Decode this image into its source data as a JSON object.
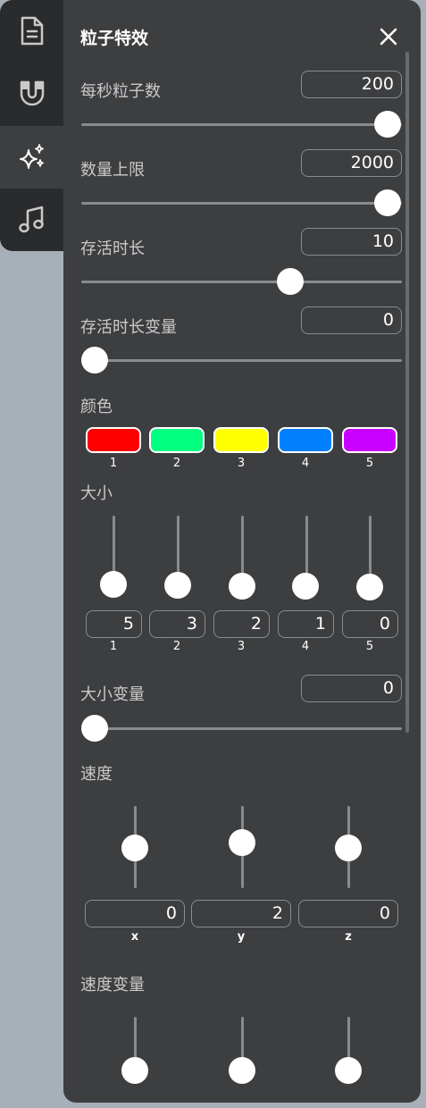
{
  "panel": {
    "title": "粒子特效"
  },
  "rail": {
    "items": [
      {
        "icon": "document-icon"
      },
      {
        "icon": "magnet-icon"
      },
      {
        "icon": "sparkles-icon",
        "active": true
      },
      {
        "icon": "music-note-icon"
      }
    ]
  },
  "controls": {
    "rate": {
      "label": "每秒粒子数",
      "value": "200",
      "fraction": 1.0
    },
    "max": {
      "label": "数量上限",
      "value": "2000",
      "fraction": 1.0
    },
    "life": {
      "label": "存活时长",
      "value": "10",
      "fraction": 0.65
    },
    "life_var": {
      "label": "存活时长变量",
      "value": "0",
      "fraction": 0.0
    },
    "size_var": {
      "label": "大小变量",
      "value": "0",
      "fraction": 0.0
    }
  },
  "colors": {
    "label": "颜色",
    "swatches": [
      {
        "index": "1",
        "color": "#ff0000"
      },
      {
        "index": "2",
        "color": "#00ff80"
      },
      {
        "index": "3",
        "color": "#ffff00"
      },
      {
        "index": "4",
        "color": "#0080ff"
      },
      {
        "index": "5",
        "color": "#c800ff"
      }
    ]
  },
  "size": {
    "label": "大小",
    "sliders": [
      {
        "index": "1",
        "value": "5"
      },
      {
        "index": "2",
        "value": "3"
      },
      {
        "index": "3",
        "value": "2"
      },
      {
        "index": "4",
        "value": "1"
      },
      {
        "index": "5",
        "value": "0"
      }
    ]
  },
  "velocity": {
    "label": "速度",
    "sliders": [
      {
        "axis": "x",
        "value": "0"
      },
      {
        "axis": "y",
        "value": "2"
      },
      {
        "axis": "z",
        "value": "0"
      }
    ]
  },
  "velocity_var": {
    "label": "速度变量"
  }
}
